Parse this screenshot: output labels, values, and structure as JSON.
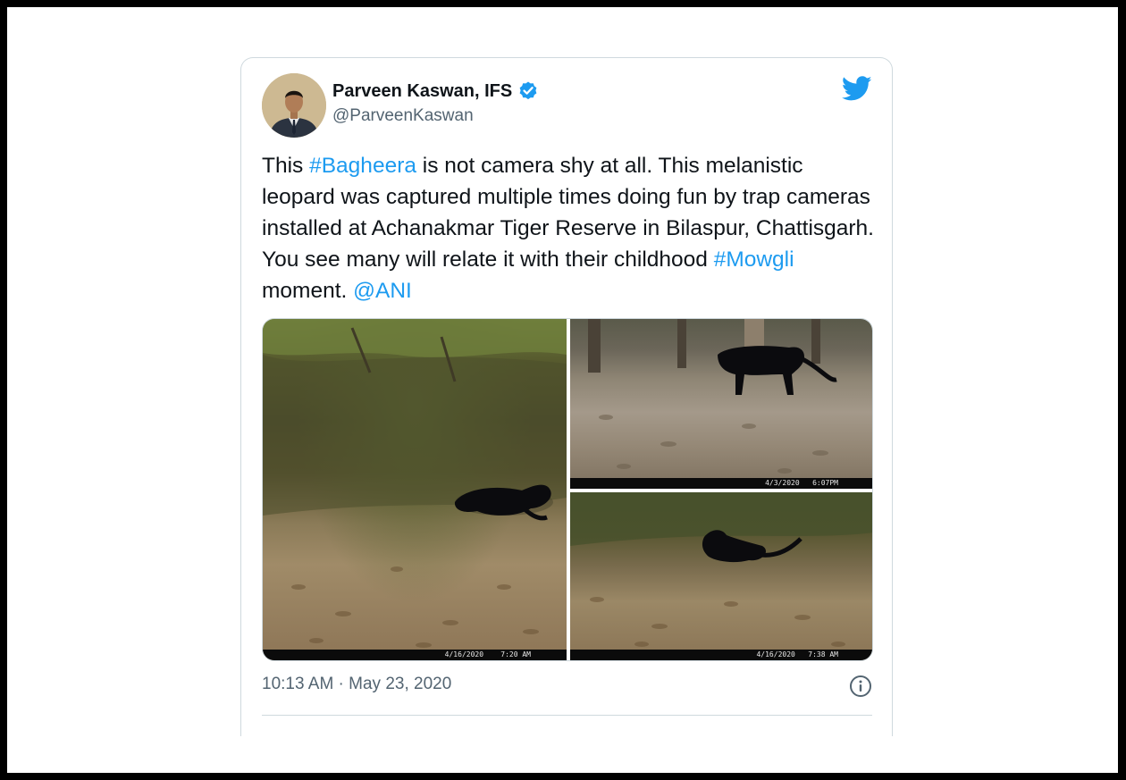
{
  "tweet": {
    "author_name": "Parveen Kaswan, IFS",
    "author_handle": "@ParveenKaswan",
    "text_segments": [
      {
        "text": "This ",
        "link": false
      },
      {
        "text": "#Bagheera",
        "link": true
      },
      {
        "text": " is not camera shy at all. This melanistic leopard was captured multiple times doing fun by trap cameras installed at Achanakmar Tiger Reserve in Bilaspur, Chattisgarh. You see many will relate it with their childhood ",
        "link": false
      },
      {
        "text": "#Mowgli",
        "link": true
      },
      {
        "text": " moment. ",
        "link": false
      },
      {
        "text": "@ANI",
        "link": true
      }
    ],
    "timestamp": "10:13 AM · May 23, 2020",
    "media": {
      "left_stamp": "4/16/2020    7:20 AM",
      "top_right_stamp": "4/3/2020   6:07PM",
      "bottom_right_stamp": "4/16/2020   7:38 AM"
    }
  },
  "colors": {
    "link": "#1d9bf0",
    "text": "#0f1419",
    "secondary": "#536471",
    "border": "#cfd9de",
    "verified_badge": "#1d9bf0",
    "twitter_bird": "#1d9bf0"
  },
  "icons": {
    "verified": "verified-badge-icon",
    "logo": "twitter-bird-icon",
    "info": "info-icon"
  }
}
